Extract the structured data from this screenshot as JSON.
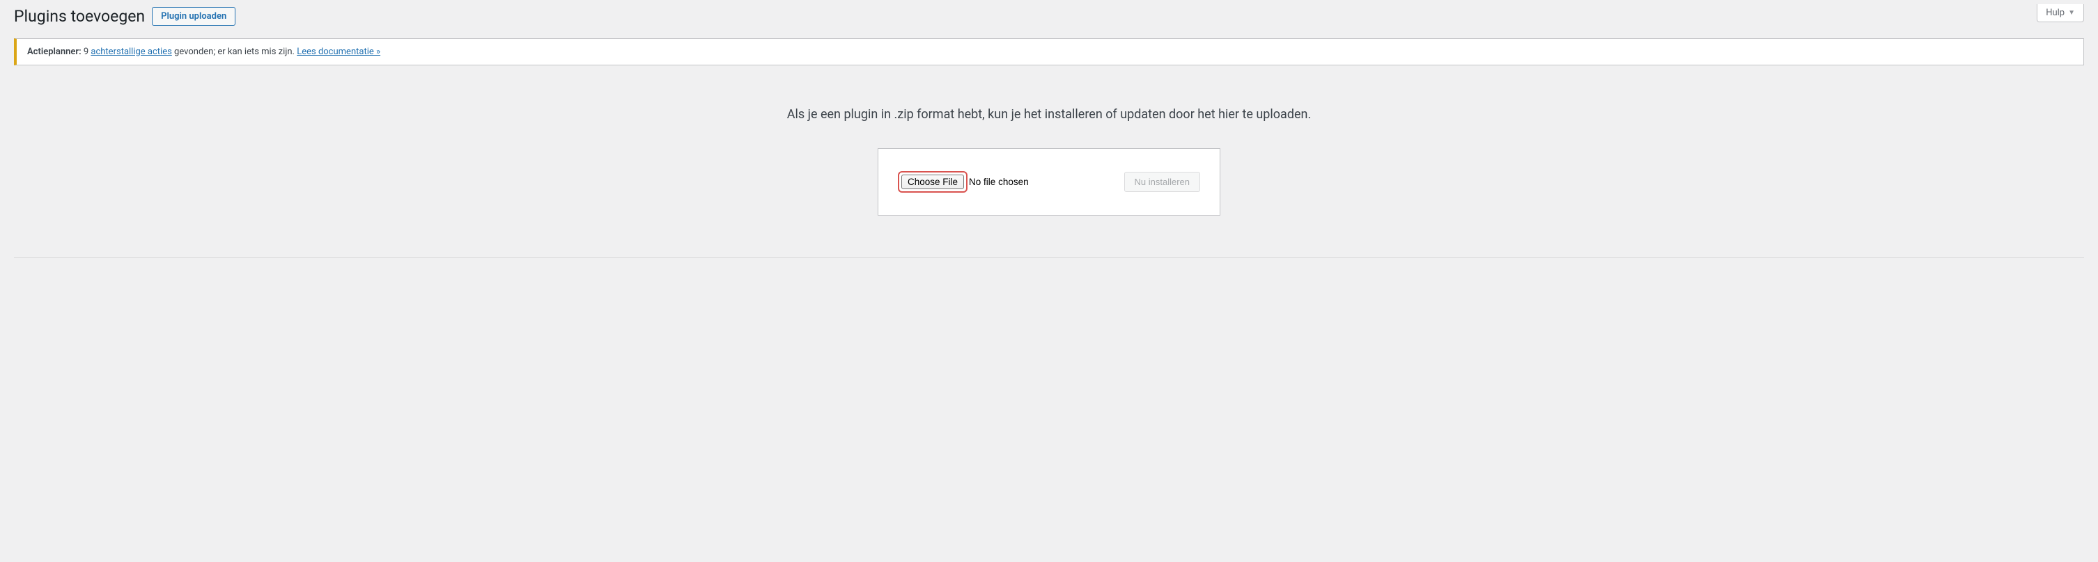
{
  "help": {
    "label": "Hulp"
  },
  "header": {
    "title": "Plugins toevoegen",
    "upload_button": "Plugin uploaden"
  },
  "notice": {
    "strong": "Actieplanner:",
    "count": "9",
    "link1": "achterstallige acties",
    "middle": "gevonden; er kan iets mis zijn.",
    "link2": "Lees documentatie »"
  },
  "upload": {
    "instructions": "Als je een plugin in .zip format hebt, kun je het installeren of updaten door het hier te uploaden.",
    "choose_file": "Choose File",
    "no_file": "No file chosen",
    "install_button": "Nu installeren"
  }
}
